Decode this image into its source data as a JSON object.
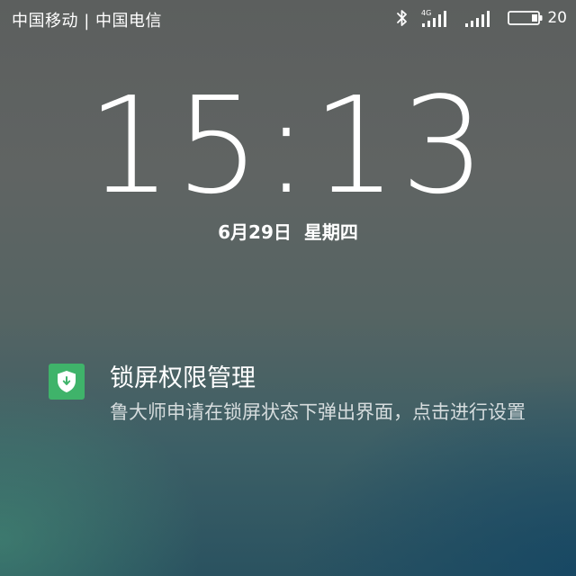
{
  "status_bar": {
    "carrier": "中国移动 | 中国电信",
    "network_label": "4G",
    "battery_level": "20",
    "icons": [
      "bluetooth-icon",
      "signal-4g-icon",
      "signal-icon",
      "battery-icon"
    ]
  },
  "lock_screen": {
    "time": "15:13",
    "date": "6月29日",
    "weekday": "星期四"
  },
  "notification": {
    "icon": "shield-download-icon",
    "icon_color": "#3fb36a",
    "title": "锁屏权限管理",
    "body": "鲁大师申请在锁屏状态下弹出界面，点击进行设置"
  }
}
